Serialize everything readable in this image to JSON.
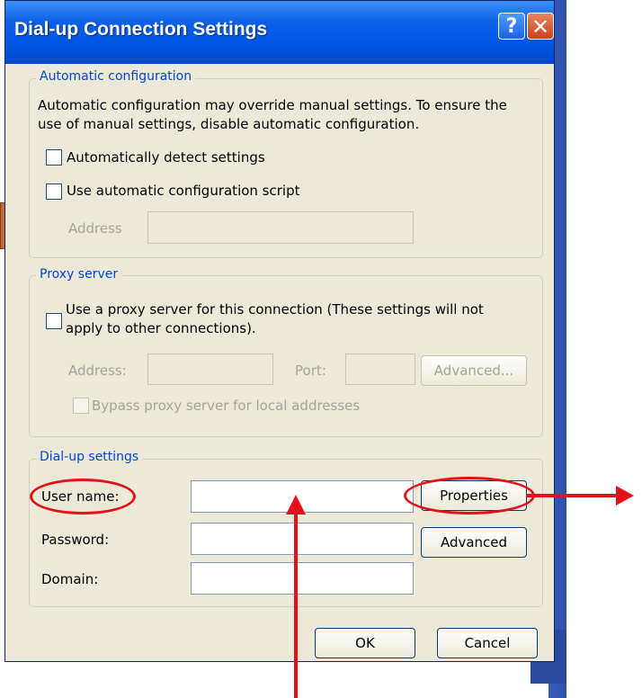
{
  "window": {
    "title": "Dial-up Connection Settings",
    "help_glyph": "?",
    "close_glyph": "✕"
  },
  "auto_config": {
    "legend": "Automatic configuration",
    "description_line1": "Automatic configuration may override manual settings.  To ensure the",
    "description_line2": "use of manual settings, disable automatic configuration.",
    "detect_label": "Automatically detect settings",
    "script_label": "Use automatic configuration script",
    "address_label": "Address",
    "address_value": ""
  },
  "proxy": {
    "legend": "Proxy server",
    "use_proxy_line1": "Use a proxy server for this connection (These settings will not",
    "use_proxy_line2": "apply to other connections).",
    "address_label": "Address:",
    "port_label": "Port:",
    "advanced_label": "Advanced...",
    "bypass_label": "Bypass proxy server for local addresses",
    "address_value": "",
    "port_value": ""
  },
  "dialup": {
    "legend": "Dial-up settings",
    "username_label": "User name:",
    "password_label": "Password:",
    "domain_label": "Domain:",
    "properties_label": "Properties",
    "advanced_label": "Advanced",
    "username_value": "",
    "password_value": "",
    "domain_value": ""
  },
  "footer": {
    "ok_label": "OK",
    "cancel_label": "Cancel"
  },
  "colors": {
    "annotation": "#e3121a",
    "titlebar": "#0055e5",
    "dialog_bg": "#ece9d8",
    "group_label": "#0046d5"
  },
  "icons": [
    "help-icon",
    "close-icon"
  ]
}
